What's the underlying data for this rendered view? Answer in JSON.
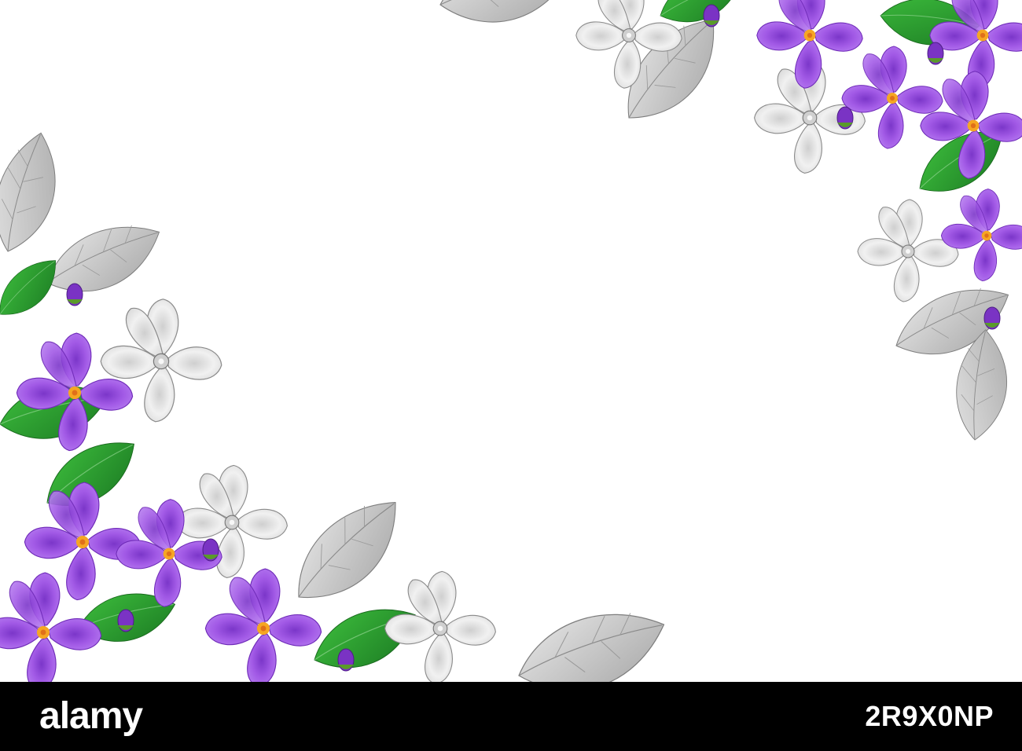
{
  "watermark": {
    "brand": "alamy",
    "image_id": "2R9X0NP",
    "bar_color": "#000000",
    "text_color": "#ffffff"
  },
  "artwork": {
    "background_color": "#ffffff",
    "colors": {
      "violet": "#9b4fe0",
      "violet_dark": "#6f2bb8",
      "flower_center": "#f5a623",
      "leaf_green": "#2fa82f",
      "leaf_green_dark": "#1e7a22",
      "pencil_gray": "#b9b9b9",
      "pencil_light": "#e8e8e8"
    }
  }
}
